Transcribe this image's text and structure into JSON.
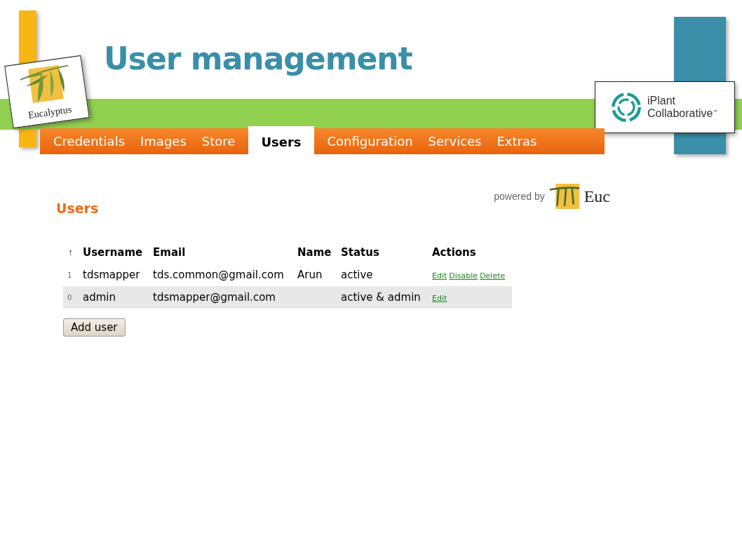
{
  "slide": {
    "title": "User management"
  },
  "logos": {
    "left": "Eucalyptus",
    "right_line_1": "iPlant",
    "right_line_2": "Collaborative",
    "right_mark": "™"
  },
  "tabs": [
    {
      "label": "Credentials",
      "selected": false
    },
    {
      "label": "Images",
      "selected": false
    },
    {
      "label": "Store",
      "selected": false
    },
    {
      "label": "Users",
      "selected": true
    },
    {
      "label": "Configuration",
      "selected": false
    },
    {
      "label": "Services",
      "selected": false
    },
    {
      "label": "Extras",
      "selected": false
    }
  ],
  "page": {
    "heading": "Users",
    "powered_by": "powered by",
    "powered_logo": "Euc",
    "table": {
      "columns": [
        "↑",
        "Username",
        "Email",
        "Name",
        "Status",
        "Actions"
      ],
      "rows": [
        {
          "index": "1",
          "username": "tdsmapper",
          "email": "tds.common@gmail.com",
          "name": "Arun",
          "status": "active",
          "actions": [
            "Edit",
            "Disable",
            "Delete"
          ]
        },
        {
          "index": "0",
          "username": "admin",
          "email": "tdsmapper@gmail.com",
          "name": "",
          "status": "active & admin",
          "actions": [
            "Edit"
          ]
        }
      ]
    },
    "add_button": "Add user"
  }
}
